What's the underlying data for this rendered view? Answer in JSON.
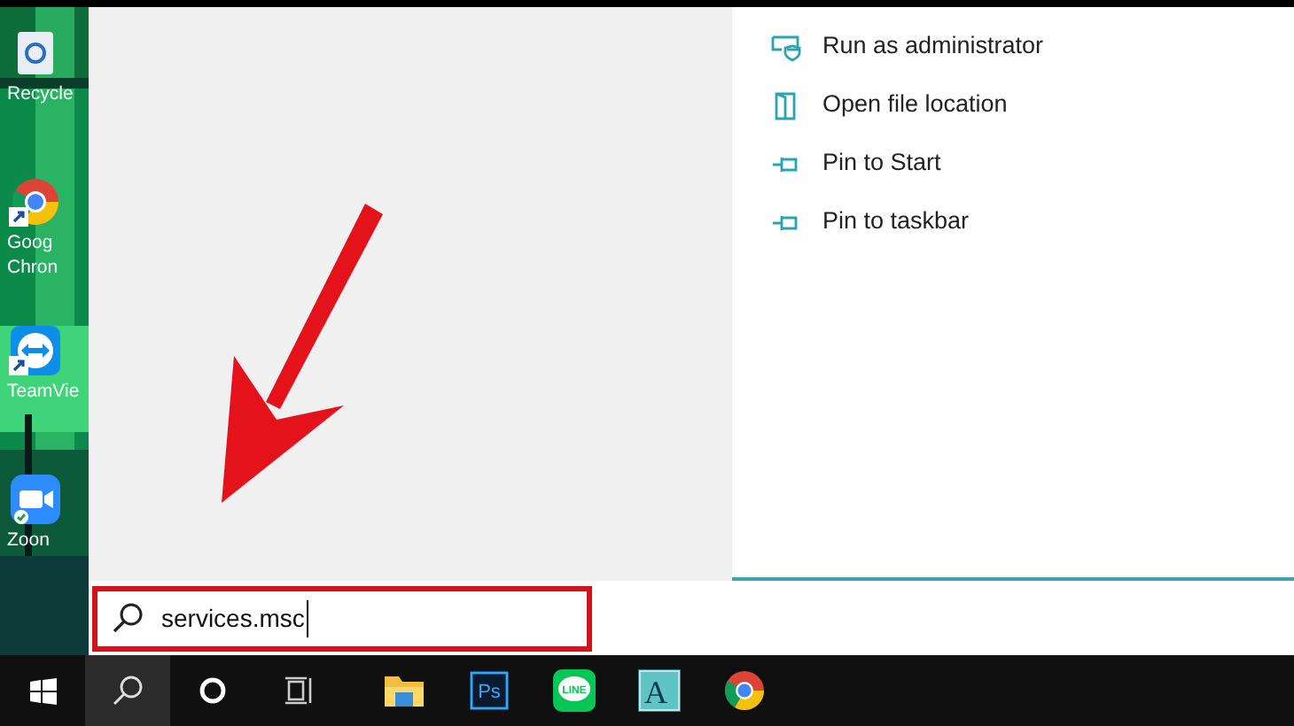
{
  "desktop_icons": [
    {
      "kind": "recycle",
      "label_lines": [
        "Recycle"
      ]
    },
    {
      "kind": "chrome",
      "label_lines": [
        "Goog",
        "Chron"
      ]
    },
    {
      "kind": "teamviewer",
      "label_lines": [
        "TeamVie"
      ]
    },
    {
      "kind": "zoom",
      "label_lines": [
        "Zoon"
      ]
    }
  ],
  "context_menu": [
    {
      "kind": "shield",
      "label": "Run as administrator"
    },
    {
      "kind": "folder",
      "label": "Open file location"
    },
    {
      "kind": "pin",
      "label": "Pin to Start"
    },
    {
      "kind": "pin",
      "label": "Pin to taskbar"
    }
  ],
  "annotation": {
    "kind": "arrow"
  },
  "search": {
    "value": "services.msc",
    "highlighted": true
  },
  "taskbar": [
    {
      "kind": "start",
      "selected": false
    },
    {
      "kind": "search",
      "selected": true
    },
    {
      "kind": "cortana",
      "selected": false
    },
    {
      "kind": "task-view",
      "selected": false
    },
    {
      "kind": "explorer",
      "selected": false
    },
    {
      "kind": "photoshop",
      "text": "Ps",
      "selected": false
    },
    {
      "kind": "line",
      "text": "LINE",
      "selected": false
    },
    {
      "kind": "app",
      "text": "A",
      "selected": false
    },
    {
      "kind": "chrome",
      "selected": false
    }
  ]
}
